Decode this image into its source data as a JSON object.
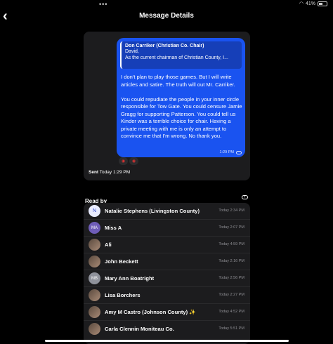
{
  "status_bar": {
    "dots": "•••",
    "battery": "41%"
  },
  "nav": {
    "back": "‹",
    "title": "Message Details"
  },
  "message": {
    "quote": {
      "author": "Don Carriker (Christian Co. Chair)",
      "lines": [
        "David,",
        "As the current chairman of Christian County, I..."
      ]
    },
    "paragraphs": [
      "I don't plan to play those games. But I will write articles and satire. The truth will out Mr. Carriker.",
      "You could repudiate the people in your inner circle responsible for Tow Gate. You could censure  Jamie Gragg for supporting Patterson. You could tell us Kinder was a terrible choice for chair. Having a private meeting with me is only an attempt to convince me that I'm wrong. No thank you."
    ],
    "time": "1:29 PM",
    "sent_label": "Sent",
    "sent_time": "Today 1:29 PM",
    "reactions": [
      "angry-reaction",
      "heart-eyes-reaction"
    ]
  },
  "read_by": {
    "title": "Read by",
    "readers": [
      {
        "name": "Natalie Stephens (Livingston County)",
        "time": "Today 2:34 PM",
        "avatar": "N",
        "avatar_style": "initial"
      },
      {
        "name": "Miss A",
        "time": "Today 2:07 PM",
        "avatar": "MA",
        "avatar_style": "initial2"
      },
      {
        "name": "Ali",
        "time": "Today 4:59 PM",
        "avatar": "",
        "avatar_style": "photo"
      },
      {
        "name": "John Beckett",
        "time": "Today 2:16 PM",
        "avatar": "",
        "avatar_style": "photo"
      },
      {
        "name": "Mary Ann Boatright",
        "time": "Today 2:56 PM",
        "avatar": "MB",
        "avatar_style": "initial3"
      },
      {
        "name": "Lisa Borchers",
        "time": "Today 2:27 PM",
        "avatar": "",
        "avatar_style": "photo"
      },
      {
        "name": "Amy M Castro (Johnson County) ✨",
        "time": "Today 4:52 PM",
        "avatar": "",
        "avatar_style": "photo"
      },
      {
        "name": "Carla Clennin Moniteau Co.",
        "time": "Today 5:51 PM",
        "avatar": "",
        "avatar_style": "photo"
      }
    ]
  }
}
